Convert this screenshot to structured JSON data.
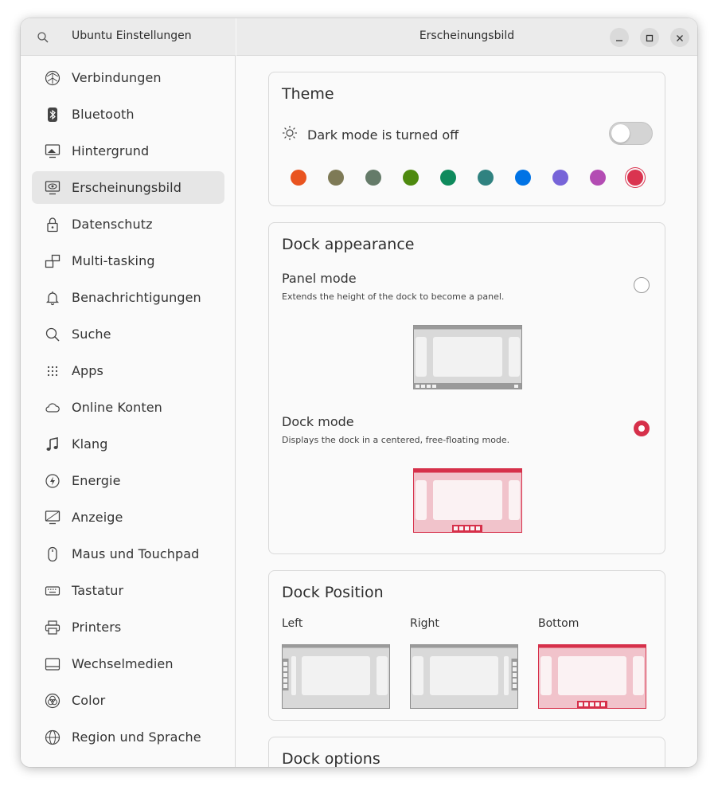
{
  "sidebar": {
    "title": "Ubuntu Einstellungen",
    "items": [
      {
        "label": "Verbindungen",
        "icon": "network-icon"
      },
      {
        "label": "Bluetooth",
        "icon": "bluetooth-icon"
      },
      {
        "label": "Hintergrund",
        "icon": "background-icon"
      },
      {
        "label": "Erscheinungsbild",
        "icon": "appearance-icon",
        "active": true
      },
      {
        "label": "Datenschutz",
        "icon": "lock-icon"
      },
      {
        "label": "Multi-tasking",
        "icon": "multitasking-icon"
      },
      {
        "label": "Benachrichtigungen",
        "icon": "bell-icon"
      },
      {
        "label": "Suche",
        "icon": "search-icon"
      },
      {
        "label": "Apps",
        "icon": "apps-grid-icon"
      },
      {
        "label": "Online Konten",
        "icon": "cloud-icon"
      },
      {
        "label": "Klang",
        "icon": "music-note-icon"
      },
      {
        "label": "Energie",
        "icon": "power-icon"
      },
      {
        "label": "Anzeige",
        "icon": "display-icon"
      },
      {
        "label": "Maus und Touchpad",
        "icon": "mouse-icon"
      },
      {
        "label": "Tastatur",
        "icon": "keyboard-icon"
      },
      {
        "label": "Printers",
        "icon": "printer-icon"
      },
      {
        "label": "Wechselmedien",
        "icon": "removable-media-icon"
      },
      {
        "label": "Color",
        "icon": "color-icon"
      },
      {
        "label": "Region und Sprache",
        "icon": "globe-icon"
      }
    ]
  },
  "header": {
    "title": "Erscheinungsbild"
  },
  "theme": {
    "title": "Theme",
    "dark_mode_label": "Dark mode is turned off",
    "dark_mode_on": false,
    "accent_colors": [
      "#e95420",
      "#7e7a56",
      "#657b69",
      "#4e8a0f",
      "#0e8a5c",
      "#308280",
      "#0073e5",
      "#7764d8",
      "#b34cb3",
      "#da3450"
    ],
    "selected_accent": "#da3450"
  },
  "dock_appearance": {
    "title": "Dock appearance",
    "panel_mode": {
      "title": "Panel mode",
      "subtitle": "Extends the height of the dock to become a panel.",
      "checked": false
    },
    "dock_mode": {
      "title": "Dock mode",
      "subtitle": "Displays the dock in a centered, free-floating mode.",
      "checked": true
    }
  },
  "dock_position": {
    "title": "Dock Position",
    "options": [
      {
        "label": "Left",
        "selected": false
      },
      {
        "label": "Right",
        "selected": false
      },
      {
        "label": "Bottom",
        "selected": true
      }
    ]
  },
  "dock_options": {
    "title": "Dock options"
  }
}
